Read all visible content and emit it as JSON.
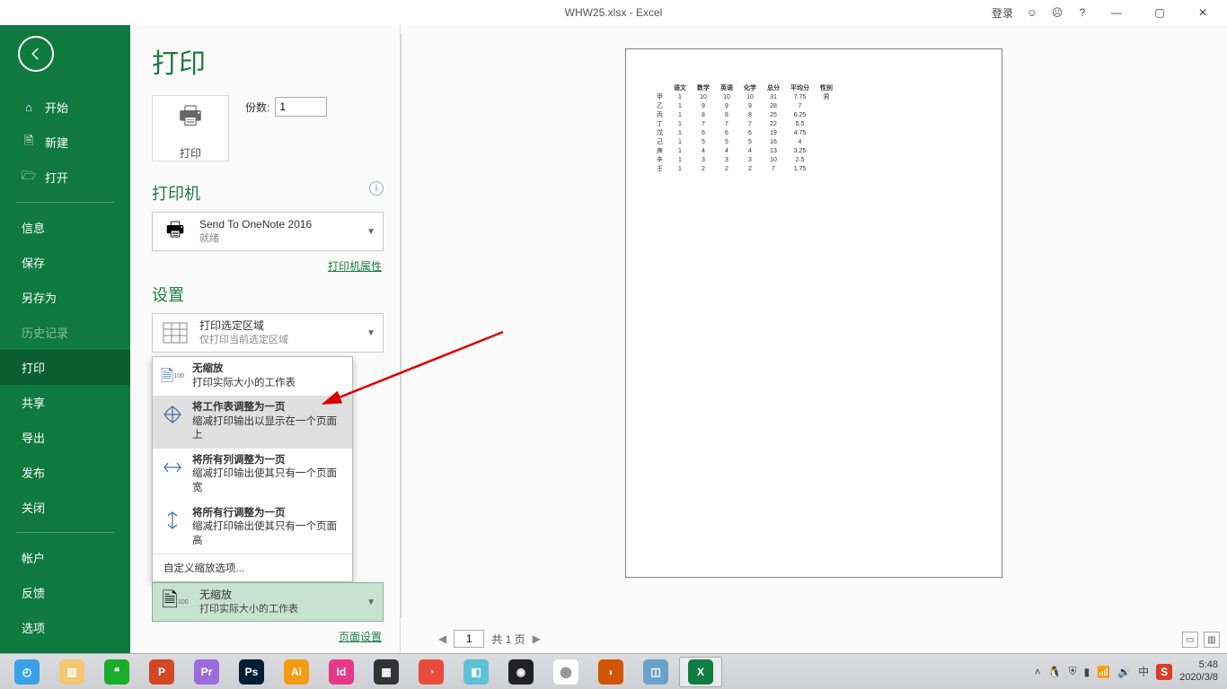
{
  "titlebar": {
    "title": "WHW25.xlsx  -  Excel",
    "login": "登录",
    "help": "?",
    "minimize": "—",
    "maximize": "▢",
    "close": "✕"
  },
  "sidebar": {
    "home": "开始",
    "new": "新建",
    "open": "打开",
    "info": "信息",
    "save": "保存",
    "saveas": "另存为",
    "history": "历史记录",
    "print": "打印",
    "share": "共享",
    "export": "导出",
    "publish": "发布",
    "close": "关闭",
    "account": "帐户",
    "feedback": "反馈",
    "options": "选项"
  },
  "print": {
    "title": "打印",
    "button": "打印",
    "copies_label": "份数:",
    "copies_value": "1",
    "printer_section": "打印机",
    "printer_name": "Send To OneNote 2016",
    "printer_status": "就绪",
    "printer_props": "打印机属性",
    "settings_section": "设置",
    "range_title": "打印选定区域",
    "range_sub": "仅打印当前选定区域",
    "scale_options": {
      "opt1_title": "无缩放",
      "opt1_sub": "打印实际大小的工作表",
      "opt2_title": "将工作表调整为一页",
      "opt2_sub": "缩减打印输出以显示在一个页面上",
      "opt3_title": "将所有列调整为一页",
      "opt3_sub": "缩减打印输出使其只有一个页面宽",
      "opt4_title": "将所有行调整为一页",
      "opt4_sub": "缩减打印输出使其只有一个页面高",
      "custom": "自定义缩放选项..."
    },
    "page_setup": "页面设置",
    "current_scale_title": "无缩放",
    "current_scale_sub": "打印实际大小的工作表"
  },
  "pager": {
    "current": "1",
    "total": "共 1 页"
  },
  "chart_data": {
    "type": "table",
    "headers": [
      "",
      "语文",
      "数学",
      "英语",
      "化学",
      "总分",
      "平均分",
      "性别"
    ],
    "rows": [
      [
        "甲",
        "1",
        "10",
        "10",
        "10",
        "31",
        "7.75",
        "男"
      ],
      [
        "乙",
        "1",
        "9",
        "9",
        "9",
        "28",
        "7",
        ""
      ],
      [
        "丙",
        "1",
        "8",
        "8",
        "8",
        "25",
        "6.25",
        ""
      ],
      [
        "丁",
        "1",
        "7",
        "7",
        "7",
        "22",
        "5.5",
        ""
      ],
      [
        "戊",
        "1",
        "6",
        "6",
        "6",
        "19",
        "4.75",
        ""
      ],
      [
        "己",
        "1",
        "5",
        "5",
        "5",
        "16",
        "4",
        ""
      ],
      [
        "庚",
        "1",
        "4",
        "4",
        "4",
        "13",
        "3.25",
        ""
      ],
      [
        "辛",
        "1",
        "3",
        "3",
        "3",
        "10",
        "2.5",
        ""
      ],
      [
        "壬",
        "1",
        "2",
        "2",
        "2",
        "7",
        "1.75",
        ""
      ]
    ]
  },
  "taskbar": {
    "time": "5:48",
    "date": "2020/3/8",
    "apps": [
      {
        "color": "#3aa0e8",
        "label": "◴"
      },
      {
        "color": "#f5c673",
        "label": "▥"
      },
      {
        "color": "#1aac2b",
        "label": "❝"
      },
      {
        "color": "#d24726",
        "label": "P"
      },
      {
        "color": "#9a6bdc",
        "label": "Pr"
      },
      {
        "color": "#001d36",
        "label": "Ps"
      },
      {
        "color": "#f39c12",
        "label": "Ai"
      },
      {
        "color": "#e6398a",
        "label": "Id"
      },
      {
        "color": "#333",
        "label": "▦"
      },
      {
        "color": "#e74c3c",
        "label": "◔"
      },
      {
        "color": "#5dc1d8",
        "label": "◧"
      },
      {
        "color": "#222",
        "label": "◉"
      },
      {
        "color": "#fff",
        "label": "⬤",
        "fg": "#999"
      },
      {
        "color": "#d35400",
        "label": "◗"
      },
      {
        "color": "#6aa3c9",
        "label": "◫"
      },
      {
        "color": "#107c41",
        "label": "X",
        "active": true
      }
    ]
  }
}
